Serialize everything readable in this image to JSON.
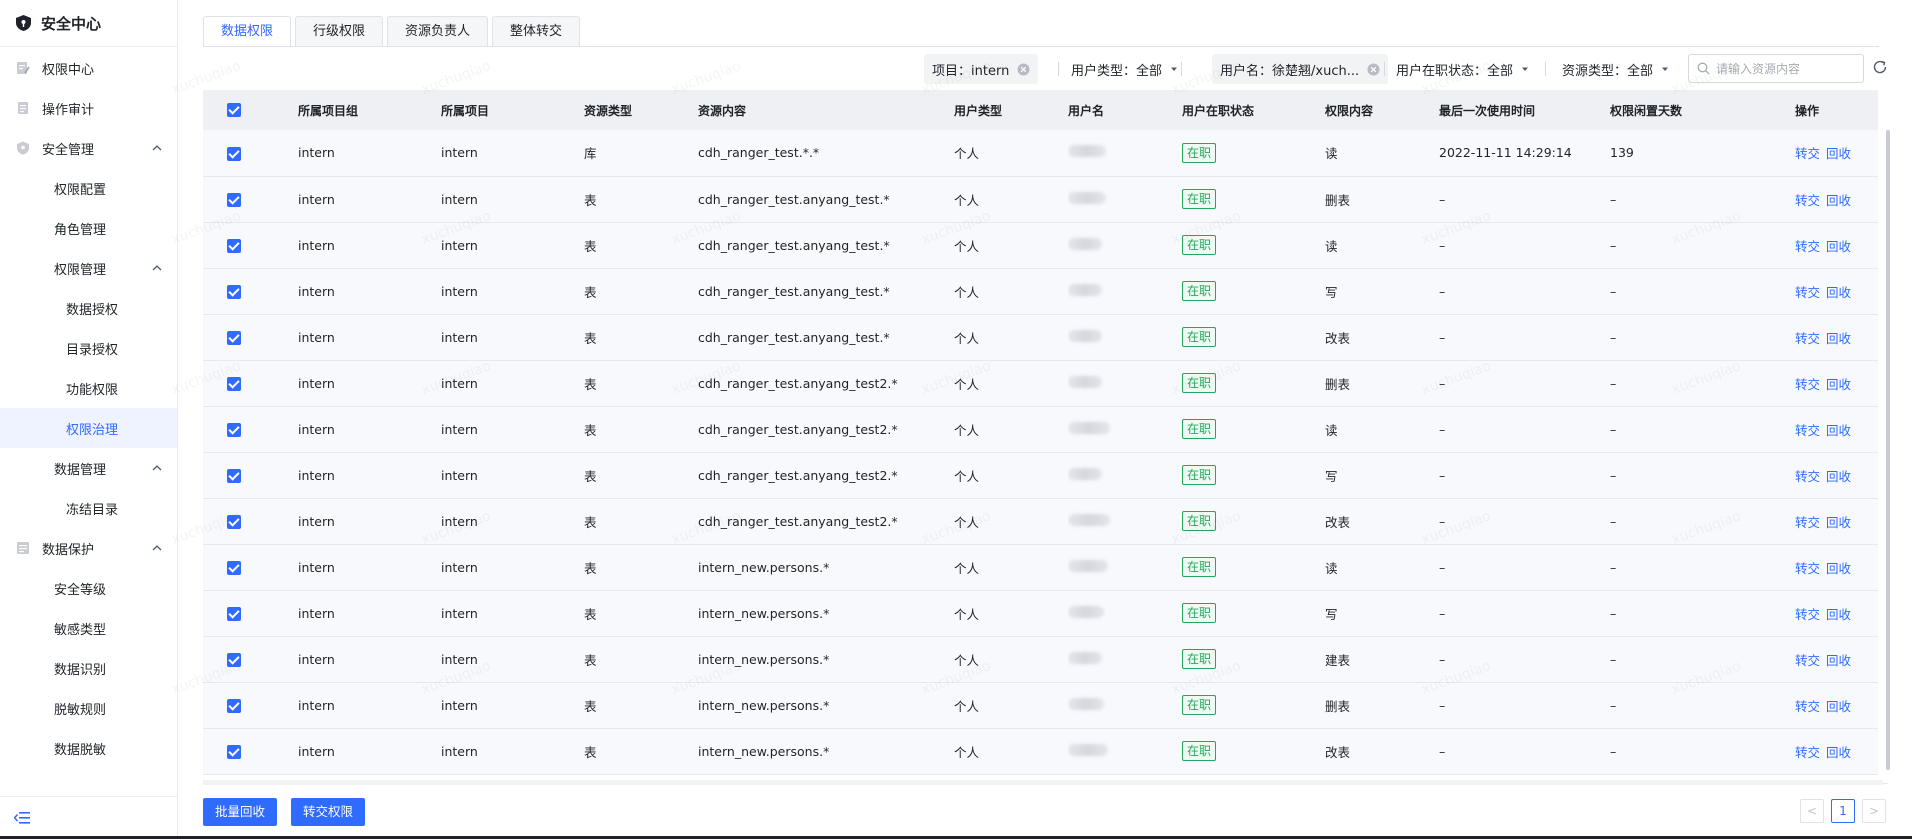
{
  "app": {
    "title": "安全中心"
  },
  "sidebar": {
    "items": [
      {
        "label": "权限中心",
        "level": 1,
        "icon": "edit-doc-icon"
      },
      {
        "label": "操作审计",
        "level": 1,
        "icon": "doc-icon"
      },
      {
        "label": "安全管理",
        "level": 1,
        "icon": "shield-icon",
        "expanded": true
      },
      {
        "label": "权限配置",
        "level": 2
      },
      {
        "label": "角色管理",
        "level": 2
      },
      {
        "label": "权限管理",
        "level": 2,
        "expanded": true
      },
      {
        "label": "数据授权",
        "level": 3
      },
      {
        "label": "目录授权",
        "level": 3
      },
      {
        "label": "功能权限",
        "level": 3
      },
      {
        "label": "权限治理",
        "level": 3,
        "active": true
      },
      {
        "label": "数据管理",
        "level": 2,
        "expanded": true
      },
      {
        "label": "冻结目录",
        "level": 3
      },
      {
        "label": "数据保护",
        "level": 1,
        "icon": "data-doc-icon",
        "expanded": true
      },
      {
        "label": "安全等级",
        "level": 2
      },
      {
        "label": "敏感类型",
        "level": 2
      },
      {
        "label": "数据识别",
        "level": 2
      },
      {
        "label": "脱敏规则",
        "level": 2
      },
      {
        "label": "数据脱敏",
        "level": 2
      }
    ]
  },
  "tabs": [
    {
      "label": "数据权限",
      "active": true
    },
    {
      "label": "行级权限"
    },
    {
      "label": "资源负责人"
    },
    {
      "label": "整体转交"
    }
  ],
  "filters": {
    "project": "项目：intern",
    "user_type": "用户类型：全部",
    "user_name": "用户名：徐楚翘/xuch...",
    "employment": "用户在职状态：全部",
    "resource_type": "资源类型：全部",
    "search_placeholder": "请输入资源内容"
  },
  "table": {
    "columns": [
      "所属项目组",
      "所属项目",
      "资源类型",
      "资源内容",
      "用户类型",
      "用户名",
      "用户在职状态",
      "权限内容",
      "最后一次使用时间",
      "权限闲置天数",
      "操作"
    ],
    "rows": [
      {
        "group": "intern",
        "project": "intern",
        "rtype": "库",
        "content": "cdh_ranger_test.*.*",
        "utype": "个人",
        "status": "在职",
        "perm": "读",
        "last_used": "2022-11-11 14:29:14",
        "idle": "139"
      },
      {
        "group": "intern",
        "project": "intern",
        "rtype": "表",
        "content": "cdh_ranger_test.anyang_test.*",
        "utype": "个人",
        "status": "在职",
        "perm": "删表",
        "last_used": "–",
        "idle": "–"
      },
      {
        "group": "intern",
        "project": "intern",
        "rtype": "表",
        "content": "cdh_ranger_test.anyang_test.*",
        "utype": "个人",
        "status": "在职",
        "perm": "读",
        "last_used": "–",
        "idle": "–"
      },
      {
        "group": "intern",
        "project": "intern",
        "rtype": "表",
        "content": "cdh_ranger_test.anyang_test.*",
        "utype": "个人",
        "status": "在职",
        "perm": "写",
        "last_used": "–",
        "idle": "–"
      },
      {
        "group": "intern",
        "project": "intern",
        "rtype": "表",
        "content": "cdh_ranger_test.anyang_test.*",
        "utype": "个人",
        "status": "在职",
        "perm": "改表",
        "last_used": "–",
        "idle": "–"
      },
      {
        "group": "intern",
        "project": "intern",
        "rtype": "表",
        "content": "cdh_ranger_test.anyang_test2.*",
        "utype": "个人",
        "status": "在职",
        "perm": "删表",
        "last_used": "–",
        "idle": "–"
      },
      {
        "group": "intern",
        "project": "intern",
        "rtype": "表",
        "content": "cdh_ranger_test.anyang_test2.*",
        "utype": "个人",
        "status": "在职",
        "perm": "读",
        "last_used": "–",
        "idle": "–"
      },
      {
        "group": "intern",
        "project": "intern",
        "rtype": "表",
        "content": "cdh_ranger_test.anyang_test2.*",
        "utype": "个人",
        "status": "在职",
        "perm": "写",
        "last_used": "–",
        "idle": "–"
      },
      {
        "group": "intern",
        "project": "intern",
        "rtype": "表",
        "content": "cdh_ranger_test.anyang_test2.*",
        "utype": "个人",
        "status": "在职",
        "perm": "改表",
        "last_used": "–",
        "idle": "–"
      },
      {
        "group": "intern",
        "project": "intern",
        "rtype": "表",
        "content": "intern_new.persons.*",
        "utype": "个人",
        "status": "在职",
        "perm": "读",
        "last_used": "–",
        "idle": "–"
      },
      {
        "group": "intern",
        "project": "intern",
        "rtype": "表",
        "content": "intern_new.persons.*",
        "utype": "个人",
        "status": "在职",
        "perm": "写",
        "last_used": "–",
        "idle": "–"
      },
      {
        "group": "intern",
        "project": "intern",
        "rtype": "表",
        "content": "intern_new.persons.*",
        "utype": "个人",
        "status": "在职",
        "perm": "建表",
        "last_used": "–",
        "idle": "–"
      },
      {
        "group": "intern",
        "project": "intern",
        "rtype": "表",
        "content": "intern_new.persons.*",
        "utype": "个人",
        "status": "在职",
        "perm": "删表",
        "last_used": "–",
        "idle": "–"
      },
      {
        "group": "intern",
        "project": "intern",
        "rtype": "表",
        "content": "intern_new.persons.*",
        "utype": "个人",
        "status": "在职",
        "perm": "改表",
        "last_used": "–",
        "idle": "–"
      }
    ],
    "actions": {
      "transfer": "转交",
      "revoke": "回收"
    }
  },
  "footer": {
    "batch_revoke": "批量回收",
    "transfer_perm": "转交权限",
    "prev": "<",
    "page": "1",
    "next": ">"
  },
  "watermark": "xuchuqiao",
  "colors": {
    "accent": "#2f6bff",
    "success": "#26a65b"
  }
}
